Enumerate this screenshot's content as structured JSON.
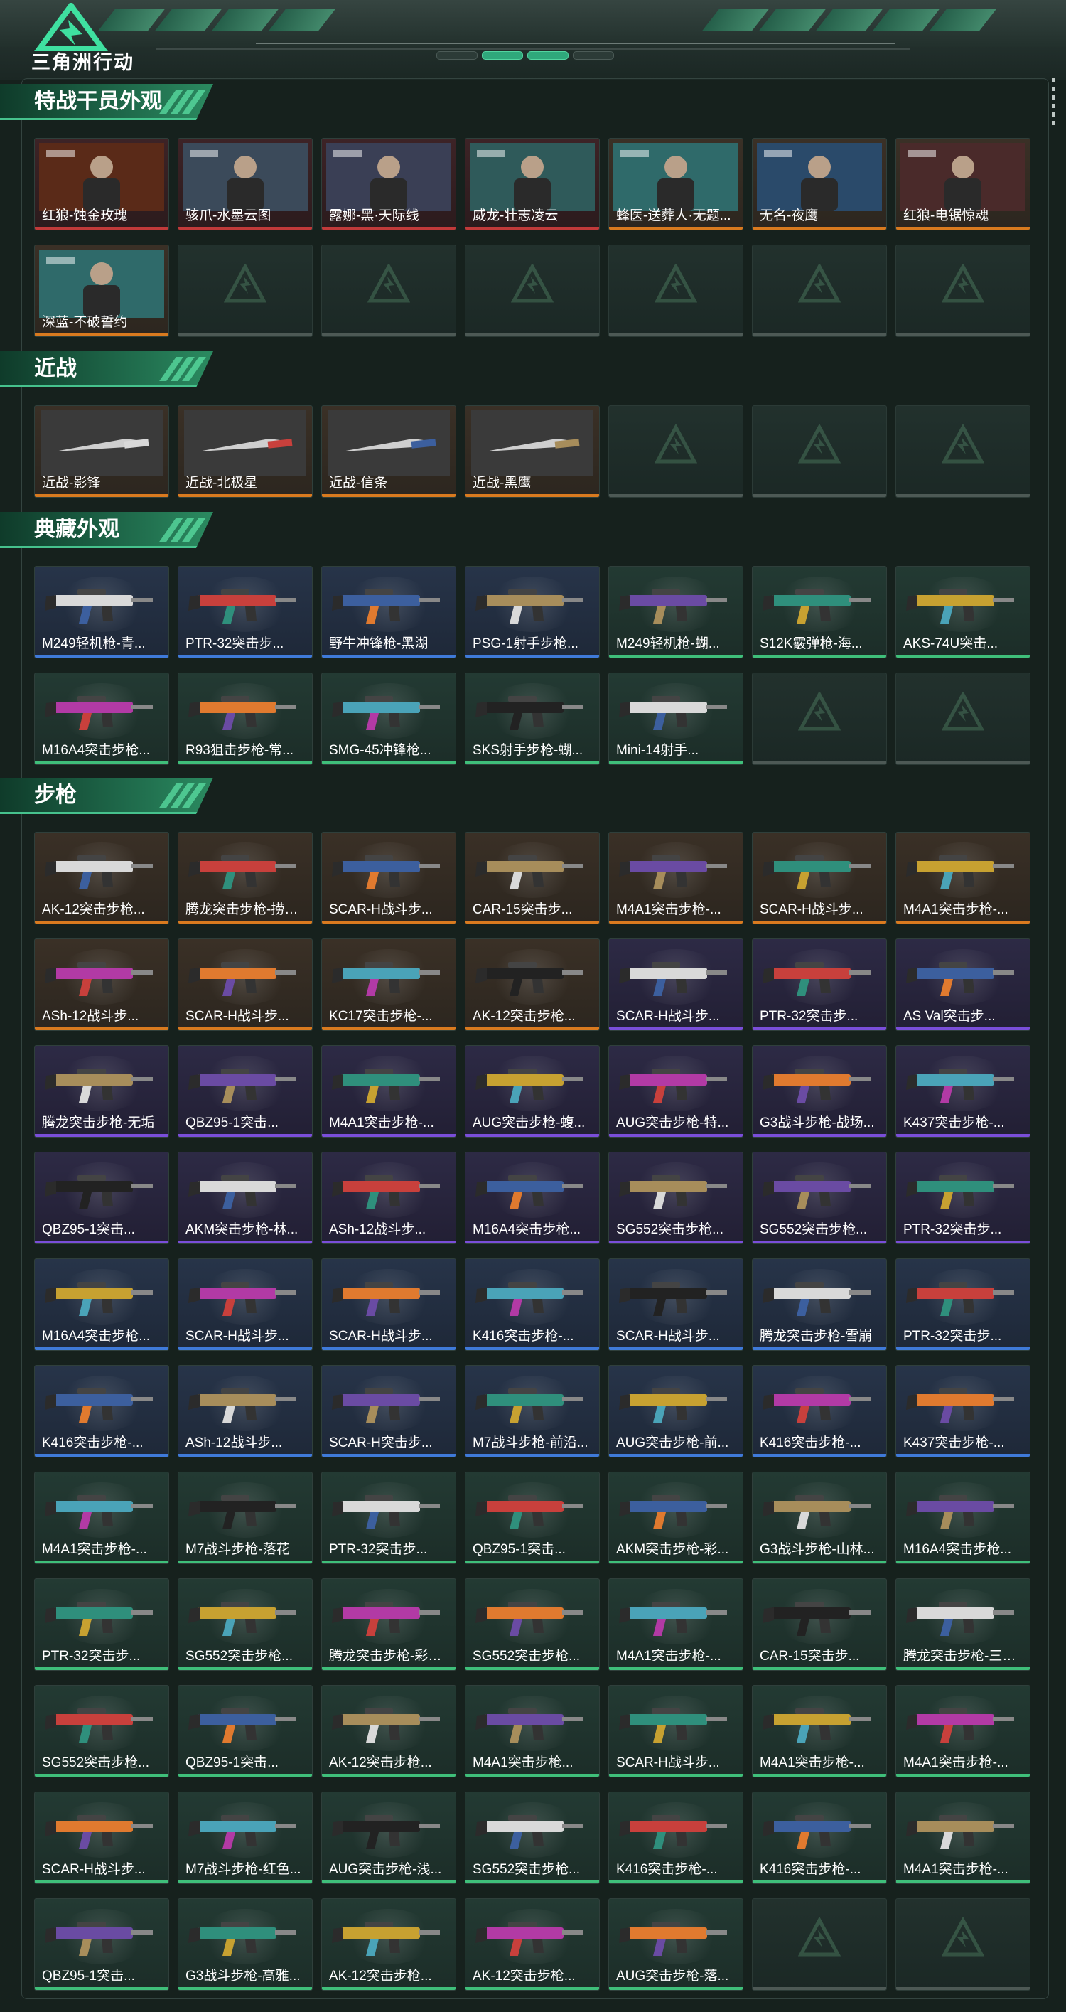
{
  "header": {
    "game_title": "三角洲行动",
    "tab_count": 2
  },
  "colors": {
    "background": "#16211d",
    "section_accent": "#46c28d",
    "quality_orange": "#d97a1f",
    "quality_purple": "#7a4ed9",
    "quality_blue": "#3f7ad9",
    "quality_green": "#3fbf7a",
    "quality_red": "#c13a3a"
  },
  "sections": [
    {
      "title": "特战干员外观",
      "items": [
        {
          "label": "红狼-蚀金玫瑰",
          "quality": "red",
          "icon": "operator-portrait"
        },
        {
          "label": "骇爪-水墨云图",
          "quality": "red",
          "icon": "operator-portrait"
        },
        {
          "label": "露娜-黑·天际线",
          "quality": "red",
          "icon": "operator-portrait"
        },
        {
          "label": "威龙-壮志凌云",
          "quality": "red",
          "icon": "operator-portrait"
        },
        {
          "label": "蜂医-送葬人·无题...",
          "quality": "orange",
          "icon": "operator-portrait"
        },
        {
          "label": "无名-夜鹰",
          "quality": "orange",
          "icon": "operator-portrait"
        },
        {
          "label": "红狼-电锯惊魂",
          "quality": "orange",
          "icon": "operator-portrait"
        },
        {
          "label": "深蓝-不破誓约",
          "quality": "orange",
          "icon": "operator-portrait"
        },
        {
          "empty": true
        },
        {
          "empty": true
        },
        {
          "empty": true
        },
        {
          "empty": true
        },
        {
          "empty": true
        },
        {
          "empty": true
        }
      ]
    },
    {
      "title": "近战",
      "items": [
        {
          "label": "近战-影锋",
          "quality": "orange",
          "icon": "knife-icon"
        },
        {
          "label": "近战-北极星",
          "quality": "orange",
          "icon": "knife-icon"
        },
        {
          "label": "近战-信条",
          "quality": "orange",
          "icon": "knife-icon"
        },
        {
          "label": "近战-黑鹰",
          "quality": "orange",
          "icon": "knife-icon"
        },
        {
          "empty": true
        },
        {
          "empty": true
        },
        {
          "empty": true
        }
      ]
    },
    {
      "title": "典藏外观",
      "items": [
        {
          "label": "M249轻机枪-青...",
          "quality": "blue",
          "icon": "lmg-icon"
        },
        {
          "label": "PTR-32突击步...",
          "quality": "blue",
          "icon": "rifle-icon"
        },
        {
          "label": "野牛冲锋枪-黑湖",
          "quality": "blue",
          "icon": "smg-icon"
        },
        {
          "label": "PSG-1射手步枪...",
          "quality": "blue",
          "icon": "sniper-icon"
        },
        {
          "label": "M249轻机枪-蝴...",
          "quality": "green",
          "icon": "lmg-icon"
        },
        {
          "label": "S12K霰弹枪-海...",
          "quality": "green",
          "icon": "shotgun-icon"
        },
        {
          "label": "AKS-74U突击...",
          "quality": "green",
          "icon": "rifle-icon"
        },
        {
          "label": "M16A4突击步枪...",
          "quality": "green",
          "icon": "rifle-icon"
        },
        {
          "label": "R93狙击步枪-常...",
          "quality": "green",
          "icon": "sniper-icon"
        },
        {
          "label": "SMG-45冲锋枪...",
          "quality": "green",
          "icon": "smg-icon"
        },
        {
          "label": "SKS射手步枪-蝴...",
          "quality": "green",
          "icon": "sniper-icon"
        },
        {
          "label": "Mini-14射手...",
          "quality": "green",
          "icon": "sniper-icon"
        },
        {
          "empty": true
        },
        {
          "empty": true
        }
      ]
    },
    {
      "title": "步枪",
      "items": [
        {
          "label": "AK-12突击步枪...",
          "quality": "orange",
          "icon": "rifle-icon"
        },
        {
          "label": "腾龙突击步枪-捞点...",
          "quality": "orange",
          "icon": "rifle-icon"
        },
        {
          "label": "SCAR-H战斗步...",
          "quality": "orange",
          "icon": "rifle-icon"
        },
        {
          "label": "CAR-15突击步...",
          "quality": "orange",
          "icon": "rifle-icon"
        },
        {
          "label": "M4A1突击步枪-...",
          "quality": "orange",
          "icon": "rifle-icon"
        },
        {
          "label": "SCAR-H战斗步...",
          "quality": "orange",
          "icon": "rifle-icon"
        },
        {
          "label": "M4A1突击步枪-...",
          "quality": "orange",
          "icon": "rifle-icon"
        },
        {
          "label": "ASh-12战斗步...",
          "quality": "orange",
          "icon": "rifle-icon"
        },
        {
          "label": "SCAR-H战斗步...",
          "quality": "orange",
          "icon": "rifle-icon"
        },
        {
          "label": "KC17突击步枪-...",
          "quality": "orange",
          "icon": "rifle-icon"
        },
        {
          "label": "AK-12突击步枪...",
          "quality": "orange",
          "icon": "rifle-icon"
        },
        {
          "label": "SCAR-H战斗步...",
          "quality": "purple",
          "icon": "rifle-icon"
        },
        {
          "label": "PTR-32突击步...",
          "quality": "purple",
          "icon": "rifle-icon"
        },
        {
          "label": "AS Val突击步...",
          "quality": "purple",
          "icon": "rifle-icon"
        },
        {
          "label": "腾龙突击步枪-无垢",
          "quality": "purple",
          "icon": "rifle-icon"
        },
        {
          "label": "QBZ95-1突击...",
          "quality": "purple",
          "icon": "rifle-icon"
        },
        {
          "label": "M4A1突击步枪-...",
          "quality": "purple",
          "icon": "rifle-icon"
        },
        {
          "label": "AUG突击步枪-蝮...",
          "quality": "purple",
          "icon": "rifle-icon"
        },
        {
          "label": "AUG突击步枪-特...",
          "quality": "purple",
          "icon": "rifle-icon"
        },
        {
          "label": "G3战斗步枪-战场...",
          "quality": "purple",
          "icon": "rifle-icon"
        },
        {
          "label": "K437突击步枪-...",
          "quality": "purple",
          "icon": "rifle-icon"
        },
        {
          "label": "QBZ95-1突击...",
          "quality": "purple",
          "icon": "rifle-icon"
        },
        {
          "label": "AKM突击步枪-林...",
          "quality": "purple",
          "icon": "rifle-icon"
        },
        {
          "label": "ASh-12战斗步...",
          "quality": "purple",
          "icon": "rifle-icon"
        },
        {
          "label": "M16A4突击步枪...",
          "quality": "purple",
          "icon": "rifle-icon"
        },
        {
          "label": "SG552突击步枪...",
          "quality": "purple",
          "icon": "rifle-icon"
        },
        {
          "label": "SG552突击步枪...",
          "quality": "purple",
          "icon": "rifle-icon"
        },
        {
          "label": "PTR-32突击步...",
          "quality": "purple",
          "icon": "rifle-icon"
        },
        {
          "label": "M16A4突击步枪...",
          "quality": "blue",
          "icon": "rifle-icon"
        },
        {
          "label": "SCAR-H战斗步...",
          "quality": "blue",
          "icon": "rifle-icon"
        },
        {
          "label": "SCAR-H战斗步...",
          "quality": "blue",
          "icon": "rifle-icon"
        },
        {
          "label": "K416突击步枪-...",
          "quality": "blue",
          "icon": "rifle-icon"
        },
        {
          "label": "SCAR-H战斗步...",
          "quality": "blue",
          "icon": "rifle-icon"
        },
        {
          "label": "腾龙突击步枪-雪崩",
          "quality": "blue",
          "icon": "rifle-icon"
        },
        {
          "label": "PTR-32突击步...",
          "quality": "blue",
          "icon": "rifle-icon"
        },
        {
          "label": "K416突击步枪-...",
          "quality": "blue",
          "icon": "rifle-icon"
        },
        {
          "label": "ASh-12战斗步...",
          "quality": "blue",
          "icon": "rifle-icon"
        },
        {
          "label": "SCAR-H突击步...",
          "quality": "blue",
          "icon": "rifle-icon"
        },
        {
          "label": "M7战斗步枪-前沿...",
          "quality": "blue",
          "icon": "rifle-icon"
        },
        {
          "label": "AUG突击步枪-前...",
          "quality": "blue",
          "icon": "rifle-icon"
        },
        {
          "label": "K416突击步枪-...",
          "quality": "blue",
          "icon": "rifle-icon"
        },
        {
          "label": "K437突击步枪-...",
          "quality": "blue",
          "icon": "rifle-icon"
        },
        {
          "label": "M4A1突击步枪-...",
          "quality": "green",
          "icon": "rifle-icon"
        },
        {
          "label": "M7战斗步枪-落花",
          "quality": "green",
          "icon": "rifle-icon"
        },
        {
          "label": "PTR-32突击步...",
          "quality": "green",
          "icon": "rifle-icon"
        },
        {
          "label": "QBZ95-1突击...",
          "quality": "green",
          "icon": "rifle-icon"
        },
        {
          "label": "AKM突击步枪-彩...",
          "quality": "green",
          "icon": "rifle-icon"
        },
        {
          "label": "G3战斗步枪-山林...",
          "quality": "green",
          "icon": "rifle-icon"
        },
        {
          "label": "M16A4突击步枪...",
          "quality": "green",
          "icon": "rifle-icon"
        },
        {
          "label": "PTR-32突击步...",
          "quality": "green",
          "icon": "rifle-icon"
        },
        {
          "label": "SG552突击步枪...",
          "quality": "green",
          "icon": "rifle-icon"
        },
        {
          "label": "腾龙突击步枪-彩墨...",
          "quality": "green",
          "icon": "rifle-icon"
        },
        {
          "label": "SG552突击步枪...",
          "quality": "green",
          "icon": "rifle-icon"
        },
        {
          "label": "M4A1突击步枪-...",
          "quality": "green",
          "icon": "rifle-icon"
        },
        {
          "label": "CAR-15突击步...",
          "quality": "green",
          "icon": "rifle-icon"
        },
        {
          "label": "腾龙突击步枪-三角...",
          "quality": "green",
          "icon": "rifle-icon"
        },
        {
          "label": "SG552突击步枪...",
          "quality": "green",
          "icon": "rifle-icon"
        },
        {
          "label": "QBZ95-1突击...",
          "quality": "green",
          "icon": "rifle-icon"
        },
        {
          "label": "AK-12突击步枪...",
          "quality": "green",
          "icon": "rifle-icon"
        },
        {
          "label": "M4A1突击步枪...",
          "quality": "green",
          "icon": "rifle-icon"
        },
        {
          "label": "SCAR-H战斗步...",
          "quality": "green",
          "icon": "rifle-icon"
        },
        {
          "label": "M4A1突击步枪-...",
          "quality": "green",
          "icon": "rifle-icon"
        },
        {
          "label": "M4A1突击步枪-...",
          "quality": "green",
          "icon": "rifle-icon"
        },
        {
          "label": "SCAR-H战斗步...",
          "quality": "green",
          "icon": "rifle-icon"
        },
        {
          "label": "M7战斗步枪-红色...",
          "quality": "green",
          "icon": "rifle-icon"
        },
        {
          "label": "AUG突击步枪-浅...",
          "quality": "green",
          "icon": "rifle-icon"
        },
        {
          "label": "SG552突击步枪...",
          "quality": "green",
          "icon": "rifle-icon"
        },
        {
          "label": "K416突击步枪-...",
          "quality": "green",
          "icon": "rifle-icon"
        },
        {
          "label": "K416突击步枪-...",
          "quality": "green",
          "icon": "rifle-icon"
        },
        {
          "label": "M4A1突击步枪-...",
          "quality": "green",
          "icon": "rifle-icon"
        },
        {
          "label": "QBZ95-1突击...",
          "quality": "green",
          "icon": "rifle-icon"
        },
        {
          "label": "G3战斗步枪-高雅...",
          "quality": "green",
          "icon": "rifle-icon"
        },
        {
          "label": "AK-12突击步枪...",
          "quality": "green",
          "icon": "rifle-icon"
        },
        {
          "label": "AK-12突击步枪...",
          "quality": "green",
          "icon": "rifle-icon"
        },
        {
          "label": "AUG突击步枪-落...",
          "quality": "green",
          "icon": "rifle-icon"
        },
        {
          "empty": true
        },
        {
          "empty": true
        }
      ]
    }
  ]
}
